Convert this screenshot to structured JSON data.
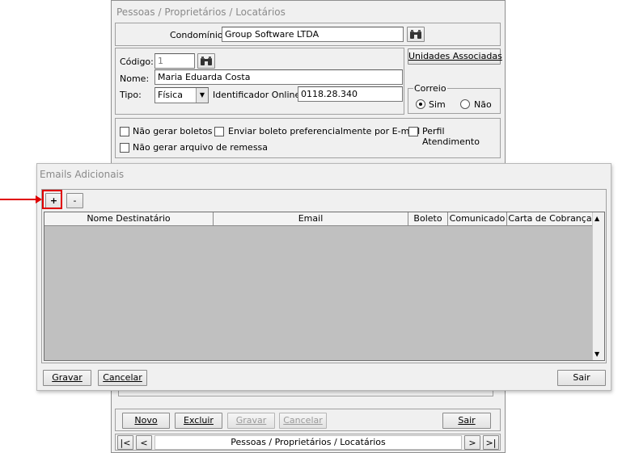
{
  "main_window": {
    "title": "Pessoas / Proprietários / Locatários",
    "condominio_label": "Condomínio:",
    "condominio_value": "Group Software LTDA",
    "codigo_label": "Código:",
    "codigo_value": "1",
    "nome_label": "Nome:",
    "nome_value": "Maria Eduarda Costa",
    "tipo_label": "Tipo:",
    "tipo_value": "Física",
    "identificador_label": "Identificador Online:",
    "identificador_value": "0118.28.340",
    "unidades_button": "Unidades Associadas",
    "correio": {
      "legend": "Correio",
      "sim": "Sim",
      "nao": "Não",
      "selected": "Sim"
    },
    "checks": {
      "nao_gerar_boletos": "Não gerar boletos",
      "enviar_boleto": "Enviar boleto preferencialmente por E-mail",
      "perfil_atendimento": "Perfil Atendimento",
      "nao_gerar_remessa": "Não gerar arquivo de remessa"
    },
    "toolbar": {
      "novo": "Novo",
      "excluir": "Excluir",
      "gravar": "Gravar",
      "cancelar": "Cancelar",
      "sair": "Sair"
    },
    "nav": {
      "first": "|<",
      "prev": "<",
      "label": "Pessoas / Proprietários / Locatários",
      "next": ">",
      "last": ">|"
    }
  },
  "dialog": {
    "title": "Emails Adicionais",
    "add": "+",
    "remove": "-",
    "columns": [
      "Nome Destinatário",
      "Email",
      "Boleto",
      "Comunicado",
      "Carta de Cobrança"
    ],
    "gravar": "Gravar",
    "cancelar": "Cancelar",
    "sair": "Sair"
  },
  "colors": {
    "highlight": "#e00000",
    "grid_body": "#c0c0c0",
    "window_bg": "#f0f0f0"
  }
}
